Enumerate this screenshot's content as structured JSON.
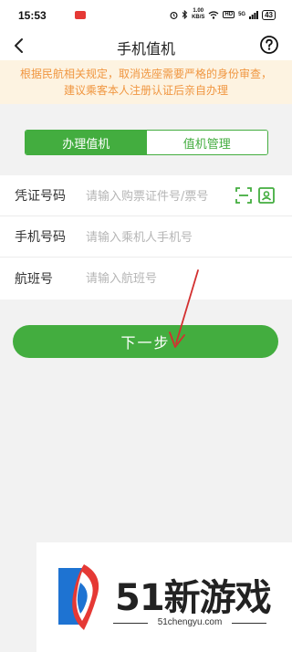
{
  "status_bar": {
    "time": "15:53",
    "speed_value": "1.00",
    "speed_unit": "KB/S",
    "hd": "HD",
    "signal_label": "5G",
    "battery": "43"
  },
  "nav": {
    "title": "手机值机"
  },
  "notice": {
    "line1": "根据民航相关规定，取消选座需要严格的身份审查，",
    "line2": "建议乘客本人注册认证后亲自办理"
  },
  "tabs": [
    {
      "label": "办理值机",
      "active": true
    },
    {
      "label": "值机管理",
      "active": false
    }
  ],
  "form": {
    "id_label": "凭证号码",
    "id_placeholder": "请输入购票证件号/票号",
    "phone_label": "手机号码",
    "phone_placeholder": "请输入乘机人手机号",
    "flight_label": "航班号",
    "flight_placeholder": "请输入航班号"
  },
  "next_button": "下一步",
  "watermark": {
    "brand": "51新游戏",
    "site": "51chengyu.com"
  },
  "colors": {
    "accent": "#43ad3f",
    "notice_text": "#f09640",
    "notice_bg": "#fdf3e1",
    "arrow": "#d32f2f"
  }
}
